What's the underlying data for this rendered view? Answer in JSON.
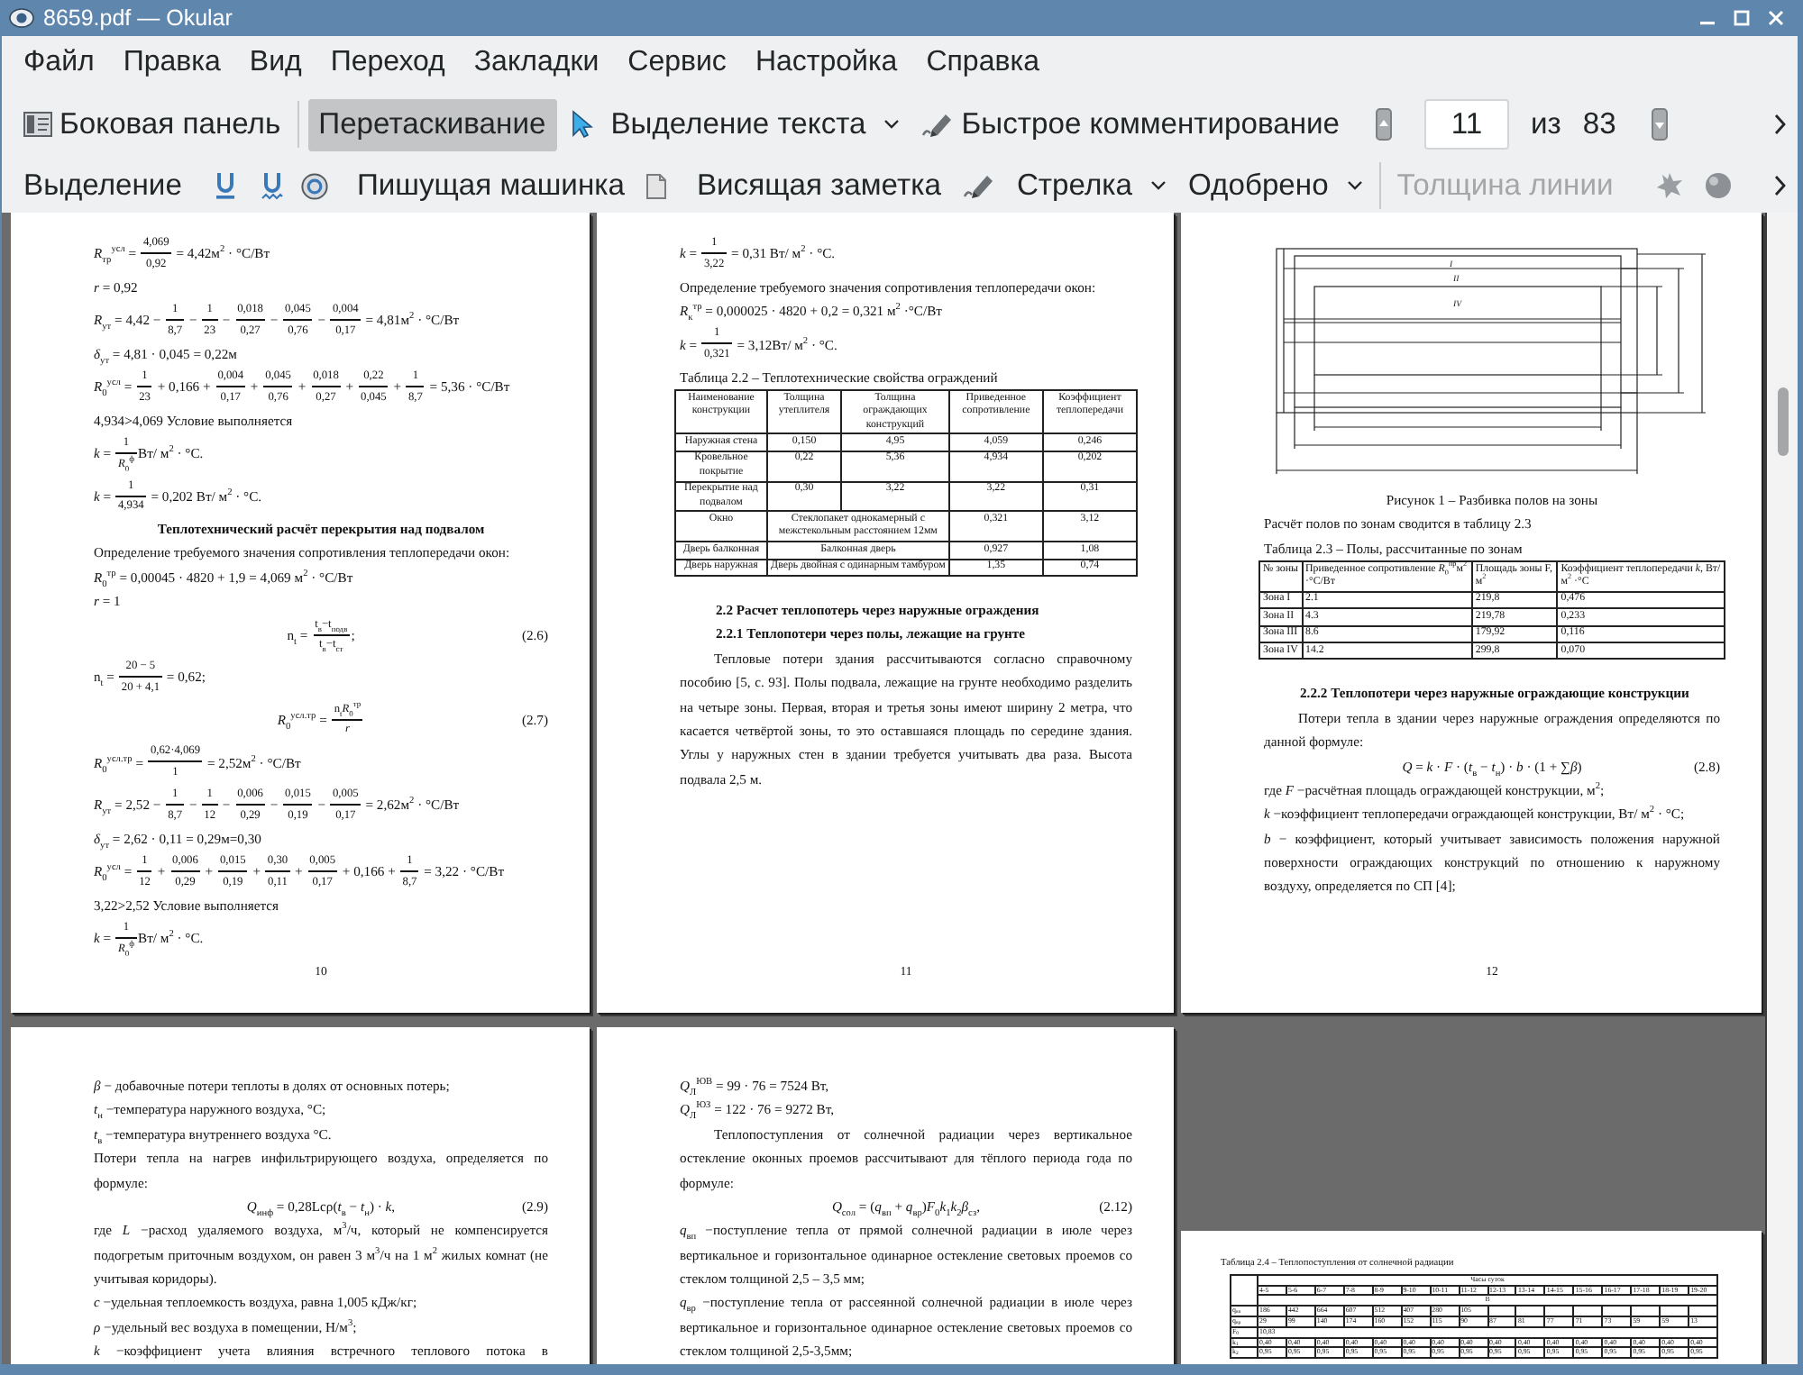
{
  "window": {
    "title": "8659.pdf — Okular"
  },
  "menu": [
    "Файл",
    "Правка",
    "Вид",
    "Переход",
    "Закладки",
    "Сервис",
    "Настройка",
    "Справка"
  ],
  "main_toolbar": {
    "tools": [
      {
        "label": "Боковая панель",
        "selected": false,
        "dropdown": false
      },
      {
        "label": "Перетаскивание",
        "selected": true,
        "dropdown": false
      },
      {
        "label": "Выделение текста",
        "selected": false,
        "dropdown": true
      },
      {
        "label": "Быстрое комментирование",
        "selected": false,
        "dropdown": false
      }
    ],
    "page_field": "11",
    "page_of": "из",
    "page_count": "83"
  },
  "annotation_toolbar": {
    "tools": [
      {
        "label": "Выделение",
        "dropdown": false
      },
      {
        "label": "Пишущая машинка",
        "dropdown": false
      },
      {
        "label": "Висящая заметка",
        "dropdown": false
      },
      {
        "label": "Стрелка",
        "dropdown": true
      },
      {
        "label": "Одобрено",
        "dropdown": true
      }
    ],
    "line_width": {
      "label": "Толщина линии",
      "disabled": true
    }
  },
  "pages": [
    {
      "number": "10",
      "landscape": false,
      "blocks": [
        {
          "kind": "formula",
          "parts": [
            {
              "kind": "text",
              "text": "*R*$_{тр}$$^{усл}$ = "
            },
            {
              "kind": "frac",
              "num": "4,069",
              "den": "0,92"
            },
            {
              "kind": "text",
              "text": " = 4,42м$^{2}$ · °C/Вт"
            }
          ]
        },
        {
          "kind": "line",
          "text": "*r* = 0,92",
          "centered": false
        },
        {
          "kind": "formula",
          "parts": [
            {
              "kind": "text",
              "text": "*R*$_{ут}$ = 4,42 − "
            },
            {
              "kind": "frac",
              "num": "1",
              "den": "8,7"
            },
            {
              "kind": "text",
              "text": " − "
            },
            {
              "kind": "frac",
              "num": "1",
              "den": "23"
            },
            {
              "kind": "text",
              "text": " − "
            },
            {
              "kind": "frac",
              "num": "0,018",
              "den": "0,27"
            },
            {
              "kind": "text",
              "text": " − "
            },
            {
              "kind": "frac",
              "num": "0,045",
              "den": "0,76"
            },
            {
              "kind": "text",
              "text": " − "
            },
            {
              "kind": "frac",
              "num": "0,004",
              "den": "0,17"
            },
            {
              "kind": "text",
              "text": " = 4,81м$^{2}$ · °C/Вт"
            }
          ]
        },
        {
          "kind": "line",
          "text": "*δ*$_{ут}$ = 4,81 · 0,045 = 0,22м",
          "centered": false
        },
        {
          "kind": "formula",
          "parts": [
            {
              "kind": "text",
              "text": "*R*$_{0}$$^{усл}$ = "
            },
            {
              "kind": "frac",
              "num": "1",
              "den": "23"
            },
            {
              "kind": "text",
              "text": " + 0,166 + "
            },
            {
              "kind": "frac",
              "num": "0,004",
              "den": "0,17"
            },
            {
              "kind": "text",
              "text": " + "
            },
            {
              "kind": "frac",
              "num": "0,045",
              "den": "0,76"
            },
            {
              "kind": "text",
              "text": " + "
            },
            {
              "kind": "frac",
              "num": "0,018",
              "den": "0,27"
            },
            {
              "kind": "text",
              "text": " + "
            },
            {
              "kind": "frac",
              "num": "0,22",
              "den": "0,045"
            },
            {
              "kind": "text",
              "text": " + "
            },
            {
              "kind": "frac",
              "num": "1",
              "den": "8,7"
            },
            {
              "kind": "text",
              "text": " = 5,36 · °C/Вт"
            }
          ]
        },
        {
          "kind": "line",
          "text": "4,934>4,069 Условие выполняется",
          "centered": false
        },
        {
          "kind": "formula",
          "parts": [
            {
              "kind": "text",
              "text": "*k* = "
            },
            {
              "kind": "frac",
              "num": "1",
              "den": "*R*$_{0}$$^{ф}$"
            },
            {
              "kind": "text",
              "text": "Вт/ м$^{2}$ · °C."
            }
          ]
        },
        {
          "kind": "formula",
          "parts": [
            {
              "kind": "text",
              "text": "*k* = "
            },
            {
              "kind": "frac",
              "num": "1",
              "den": "4,934"
            },
            {
              "kind": "text",
              "text": " = 0,202 Вт/ м$^{2}$ · °C."
            }
          ]
        },
        {
          "kind": "heading",
          "text": "Теплотехнический расчёт перекрытия над подвалом",
          "centered": true
        },
        {
          "kind": "line",
          "text": "Определение требуемого значения сопротивления теплопередачи окон:",
          "centered": false
        },
        {
          "kind": "line",
          "text": "*R*$_{0}$$^{тр}$ = 0,00045 · 4820 + 1,9 = 4,069 м$^{2}$ · °C/Вт",
          "centered": false
        },
        {
          "kind": "line",
          "text": "*r* = 1",
          "centered": false
        },
        {
          "kind": "formula",
          "number": "(2.6)",
          "parts": [
            {
              "kind": "text",
              "text": "n$_{t}$ = "
            },
            {
              "kind": "frac",
              "num": "t$_{в}$−t$_{подв}$",
              "den": "t$_{в}$−t$_{ст}$"
            },
            {
              "kind": "text",
              "text": ";"
            }
          ]
        },
        {
          "kind": "formula",
          "parts": [
            {
              "kind": "text",
              "text": "n$_{t}$ = "
            },
            {
              "kind": "frac",
              "num": "20 − 5",
              "den": "20 + 4,1"
            },
            {
              "kind": "text",
              "text": " = 0,62;"
            }
          ]
        },
        {
          "kind": "formula",
          "number": "(2.7)",
          "parts": [
            {
              "kind": "text",
              "text": "*R*$_{0}$$^{усл.тр}$ = "
            },
            {
              "kind": "frac",
              "num": "n$_{t}$*R*$_{0}$$^{тр}$",
              "den": "*r*"
            }
          ]
        },
        {
          "kind": "formula",
          "parts": [
            {
              "kind": "text",
              "text": "*R*$_{0}$$^{усл.тр}$ = "
            },
            {
              "kind": "frac",
              "num": "0,62·4,069",
              "den": "1"
            },
            {
              "kind": "text",
              "text": " = 2,52м$^{2}$ · °C/Вт"
            }
          ]
        },
        {
          "kind": "formula",
          "parts": [
            {
              "kind": "text",
              "text": "*R*$_{ут}$ = 2,52 − "
            },
            {
              "kind": "frac",
              "num": "1",
              "den": "8,7"
            },
            {
              "kind": "text",
              "text": " − "
            },
            {
              "kind": "frac",
              "num": "1",
              "den": "12"
            },
            {
              "kind": "text",
              "text": " − "
            },
            {
              "kind": "frac",
              "num": "0,006",
              "den": "0,29"
            },
            {
              "kind": "text",
              "text": " − "
            },
            {
              "kind": "frac",
              "num": "0,015",
              "den": "0,19"
            },
            {
              "kind": "text",
              "text": " − "
            },
            {
              "kind": "frac",
              "num": "0,005",
              "den": "0,17"
            },
            {
              "kind": "text",
              "text": " = 2,62м$^{2}$ · °C/Вт"
            }
          ]
        },
        {
          "kind": "line",
          "text": "*δ*$_{ут}$ = 2,62 · 0,11 = 0,29м=0,30",
          "centered": false
        },
        {
          "kind": "formula",
          "parts": [
            {
              "kind": "text",
              "text": "*R*$_{0}$$^{усл}$ = "
            },
            {
              "kind": "frac",
              "num": "1",
              "den": "12"
            },
            {
              "kind": "text",
              "text": " + "
            },
            {
              "kind": "frac",
              "num": "0,006",
              "den": "0,29"
            },
            {
              "kind": "text",
              "text": " + "
            },
            {
              "kind": "frac",
              "num": "0,015",
              "den": "0,19"
            },
            {
              "kind": "text",
              "text": " + "
            },
            {
              "kind": "frac",
              "num": "0,30",
              "den": "0,11"
            },
            {
              "kind": "text",
              "text": " + "
            },
            {
              "kind": "frac",
              "num": "0,005",
              "den": "0,17"
            },
            {
              "kind": "text",
              "text": " + 0,166 + "
            },
            {
              "kind": "frac",
              "num": "1",
              "den": "8,7"
            },
            {
              "kind": "text",
              "text": " = 3,22 · °C/Вт"
            }
          ]
        },
        {
          "kind": "line",
          "text": "3,22>2,52 Условие выполняется",
          "centered": false
        },
        {
          "kind": "formula",
          "parts": [
            {
              "kind": "text",
              "text": "*k* = "
            },
            {
              "kind": "frac",
              "num": "1",
              "den": "*R*$_{0}$$^{ф}$"
            },
            {
              "kind": "text",
              "text": "Вт/ м$^{2}$ · °C."
            }
          ]
        }
      ]
    },
    {
      "number": "11",
      "landscape": false,
      "blocks": [
        {
          "kind": "formula",
          "parts": [
            {
              "kind": "text",
              "text": "*k* = "
            },
            {
              "kind": "frac",
              "num": "1",
              "den": "3,22"
            },
            {
              "kind": "text",
              "text": " = 0,31 Вт/ м$^{2}$ · °C."
            }
          ]
        },
        {
          "kind": "line",
          "text": "Определение требуемого значения сопротивления теплопередачи окон:",
          "centered": false
        },
        {
          "kind": "line",
          "text": "*R*$_{к}$$^{тр}$ = 0,000025 · 4820 + 0,2 = 0,321 м$^{2}$ ·°C/Вт",
          "centered": false
        },
        {
          "kind": "formula",
          "parts": [
            {
              "kind": "text",
              "text": "*k* = "
            },
            {
              "kind": "frac",
              "num": "1",
              "den": "0,321"
            },
            {
              "kind": "text",
              "text": " = 3,12Вт/ м$^{2}$ · °C."
            }
          ]
        },
        {
          "kind": "line",
          "text": "Таблица 2.2 – Теплотехнические свойства ограждений",
          "centered": false
        },
        {
          "kind": "table",
          "centered": true,
          "header": [
            "Наименование конструкции",
            "Толщина утеплителя",
            "Толщина ограждающих конструкций",
            "Приведенное сопротивление",
            "Коэффициент теплопередачи"
          ],
          "rows": [
            [
              {
                "text": "Наружная стена"
              },
              {
                "text": "0,150"
              },
              {
                "text": "4,95"
              },
              {
                "text": "4,059"
              },
              {
                "text": "0,246"
              }
            ],
            [
              {
                "text": "Кровельное покрытие"
              },
              {
                "text": "0,22"
              },
              {
                "text": "5,36"
              },
              {
                "text": "4,934"
              },
              {
                "text": "0,202"
              }
            ],
            [
              {
                "text": "Перекрытие над подвалом"
              },
              {
                "text": "0,30"
              },
              {
                "text": "3,22"
              },
              {
                "text": "3,22"
              },
              {
                "text": "0,31"
              }
            ],
            [
              {
                "text": "Окно"
              },
              {
                "text": "Стеклопакет однокамерный с межстекольным расстоянием 12мм",
                "colspan": 2
              },
              {
                "text": "0,321"
              },
              {
                "text": "3,12"
              }
            ],
            [
              {
                "text": "Дверь балконная"
              },
              {
                "text": "Балконная дверь",
                "colspan": 2
              },
              {
                "text": "0,927"
              },
              {
                "text": "1,08"
              }
            ],
            [
              {
                "text": "Дверь наружная"
              },
              {
                "text": "Дверь двойная с одинарным тамбуром",
                "colspan": 2
              },
              {
                "text": "1,35"
              },
              {
                "text": "0,74"
              }
            ]
          ]
        },
        {
          "kind": "heading",
          "text": "2.2 Расчет теплопотерь через наружные ограждения",
          "centered": false
        },
        {
          "kind": "heading",
          "text": "2.2.1 Теплопотери через полы, лежащие на грунте",
          "centered": false
        },
        {
          "kind": "paragraph",
          "text": "Тепловые потери здания рассчитываются согласно справочному пособию [5, с. 93]. Полы подвала, лежащие на грунте необходимо разделить на четыре зоны. Первая, вторая и третья зоны имеют ширину 2 метра, что касается четвёртой зоны, то это оставшаяся площадь по середине здания. Углы у наружных стен в здании требуется учитывать два раза. Высота подвала 2,5 м.",
          "indent": true
        }
      ]
    },
    {
      "number": "12",
      "landscape": false,
      "blocks": [
        {
          "kind": "figure",
          "labels": [
            "I",
            "II",
            "IV"
          ]
        },
        {
          "kind": "line",
          "text": "Рисунок 1 – Разбивка полов на зоны",
          "centered": true
        },
        {
          "kind": "line",
          "text": "Расчёт полов по зонам сводится в таблицу 2.3",
          "centered": false
        },
        {
          "kind": "line",
          "text": "Таблица 2.3 – Полы, рассчитанные по зонам",
          "centered": false
        },
        {
          "kind": "table",
          "centered": false,
          "header": [
            "№ зоны",
            "Приведенное сопротивление *R*$_{0}$$^{пр}$м$^{2}$ ·°C/Вт",
            "Площадь зоны F, м$^{2}$",
            "Коэффициент теплопередачи *k*, Вт/ м$^{2}$ ·°C"
          ],
          "rows": [
            [
              {
                "text": "Зона I"
              },
              {
                "text": "2.1"
              },
              {
                "text": "219,8"
              },
              {
                "text": "0,476"
              }
            ],
            [
              {
                "text": "Зона II"
              },
              {
                "text": "4.3"
              },
              {
                "text": "219,78"
              },
              {
                "text": "0,233"
              }
            ],
            [
              {
                "text": "Зона III"
              },
              {
                "text": "8.6"
              },
              {
                "text": "179,92"
              },
              {
                "text": "0,116"
              }
            ],
            [
              {
                "text": "Зона IV"
              },
              {
                "text": "14.2"
              },
              {
                "text": "299,8"
              },
              {
                "text": "0,070"
              }
            ]
          ]
        },
        {
          "kind": "heading",
          "text": "2.2.2 Теплопотери через наружные ограждающие конструкции",
          "centered": false
        },
        {
          "kind": "paragraph",
          "text": "Потери тепла в здании через наружные ограждения определяются по данной формуле:",
          "indent": true
        },
        {
          "kind": "formula",
          "number": "(2.8)",
          "parts": [
            {
              "kind": "text",
              "text": "*Q* = *k* · *F* · (*t*$_{в}$ − *t*$_{н}$) · *b* · (1 + ∑*β*)"
            }
          ]
        },
        {
          "kind": "line",
          "text": "где *F* −расчётная площадь ограждающей конструкции, м$^{2}$;",
          "centered": false
        },
        {
          "kind": "line",
          "text": "*k* −коэффициент теплопередачи ограждающей конструкции, Вт/ м$^{2}$ · °C;",
          "centered": false
        },
        {
          "kind": "paragraph",
          "text": "*b* − коэффициент, который учитывает зависимость положения наружной поверхности ограждающих конструкций по отношению к наружному воздуху, определяется по СП [4];",
          "indent": false
        }
      ]
    },
    {
      "landscape": false,
      "blocks": [
        {
          "kind": "line",
          "text": "*β* − добавочные потери теплоты в долях от основных потерь;",
          "centered": false
        },
        {
          "kind": "line",
          "text": "*t*$_{н}$ −температура наружного воздуха, °C;",
          "centered": false
        },
        {
          "kind": "line",
          "text": "*t*$_{в}$ −температура внутреннего воздуха °C.",
          "centered": false
        },
        {
          "kind": "paragraph",
          "text": "Потери тепла на нагрев инфильтрирующего воздуха, определяется по формуле:",
          "indent": false
        },
        {
          "kind": "formula",
          "number": "(2.9)",
          "parts": [
            {
              "kind": "text",
              "text": "*Q*$_{инф}$ = 0,28Lcρ(*t*$_{в}$ − *t*$_{н}$) · *k*,"
            }
          ]
        },
        {
          "kind": "paragraph",
          "text": "где *L* −расход удаляемого воздуха, м$^{3}$/ч, который не компенсируется подогретым приточным воздухом, он равен 3 м$^{3}$/ч на 1 м$^{2}$ жилых комнат (не учитывая коридоры).",
          "indent": false
        },
        {
          "kind": "line",
          "text": "*c* −удельная теплоемкость воздуха, равна 1,005 кДж/кг;",
          "centered": false
        },
        {
          "kind": "line",
          "text": "*ρ* −удельный вес воздуха в помещении, Н/м$^{3}$;",
          "centered": false
        },
        {
          "kind": "paragraph",
          "text": "*k* −коэффициент учета влияния встречного теплового потока в",
          "indent": false,
          "continues": true
        }
      ]
    },
    {
      "landscape": false,
      "blocks": [
        {
          "kind": "line",
          "text": "*Q*$_{Л}$$^{ЮВ}$ = 99 · 76 = 7524 Вт,",
          "centered": false
        },
        {
          "kind": "line",
          "text": "*Q*$_{Л}$$^{ЮЗ}$ = 122 · 76 = 9272 Вт,",
          "centered": false
        },
        {
          "kind": "paragraph",
          "text": "Теплопоступления от солнечной радиации через вертикальное остекление оконных проемов рассчитывают для тёплого периода года по формуле:",
          "indent": true
        },
        {
          "kind": "formula",
          "number": "(2.12)",
          "parts": [
            {
              "kind": "text",
              "text": "*Q*$_{сол}$ = (*q*$_{вп}$ + *q*$_{вр}$)*F*$_{0}$*k*$_{1}$*k*$_{2}$*β*$_{сз}$,"
            }
          ]
        },
        {
          "kind": "paragraph",
          "text": "*q*$_{вп}$ −поступление тепла от прямой солнечной радиации в июле через вертикальное и горизонтальное одинарное остекление световых проемов со стеклом толщиной 2,5 – 3,5 мм;",
          "indent": false
        },
        {
          "kind": "paragraph",
          "text": "*q*$_{вр}$ −поступление тепла от рассеянной солнечной радиации в июле через вертикальное и горизонтальное одинарное остекление световых проемов со стеклом толщиной 2,5-3,5мм;",
          "indent": false
        }
      ]
    },
    {
      "landscape": true,
      "blocks": [
        {
          "kind": "line",
          "text": "Таблица 2.4 – Теплопоступления от солнечной радиации",
          "centered": false
        },
        {
          "kind": "hourly_table",
          "title": "Часы суток",
          "hours": [
            "4-5",
            "5-6",
            "6-7",
            "7-8",
            "8-9",
            "9-10",
            "10-11",
            "11-12",
            "12-13",
            "13-14",
            "14-15",
            "15-16",
            "16-17",
            "17-18",
            "18-19",
            "19-20"
          ],
          "group": "В",
          "rows": [
            [
              {
                "text": "q$_{вп}$"
              },
              {
                "text": "186"
              },
              {
                "text": "442"
              },
              {
                "text": "664"
              },
              {
                "text": "607"
              },
              {
                "text": "512"
              },
              {
                "text": "407"
              },
              {
                "text": "280"
              },
              {
                "text": "105"
              }
            ],
            [
              {
                "text": "q$_{вр}$"
              },
              {
                "text": "29"
              },
              {
                "text": "99"
              },
              {
                "text": "140"
              },
              {
                "text": "174"
              },
              {
                "text": "160"
              },
              {
                "text": "152"
              },
              {
                "text": "115"
              },
              {
                "text": "90"
              },
              {
                "text": "87"
              },
              {
                "text": "81"
              },
              {
                "text": "77"
              },
              {
                "text": "71"
              },
              {
                "text": "73"
              },
              {
                "text": "59"
              },
              {
                "text": "59"
              },
              {
                "text": "13"
              }
            ],
            [
              {
                "text": "F$_{0}$"
              },
              {
                "text": "10,83",
                "colspan": 16
              }
            ],
            [
              {
                "text": "k$_{1}$"
              },
              {
                "text": "0,40"
              },
              {
                "text": "0,40"
              },
              {
                "text": "0,40"
              },
              {
                "text": "0,40"
              },
              {
                "text": "0,40"
              },
              {
                "text": "0,40"
              },
              {
                "text": "0,40"
              },
              {
                "text": "0,40"
              },
              {
                "text": "0,40"
              },
              {
                "text": "0,40"
              },
              {
                "text": "0,40"
              },
              {
                "text": "0,40"
              },
              {
                "text": "0,40"
              },
              {
                "text": "0,40"
              },
              {
                "text": "0,40"
              },
              {
                "text": "0,40"
              }
            ],
            [
              {
                "text": "k$_{2}$"
              },
              {
                "text": "0,95"
              },
              {
                "text": "0,95"
              },
              {
                "text": "0,95"
              },
              {
                "text": "0,95"
              },
              {
                "text": "0,95"
              },
              {
                "text": "0,95"
              },
              {
                "text": "0,95"
              },
              {
                "text": "0,95"
              },
              {
                "text": "0,95"
              },
              {
                "text": "0,95"
              },
              {
                "text": "0,95"
              },
              {
                "text": "0,95"
              },
              {
                "text": "0,95"
              },
              {
                "text": "0,95"
              },
              {
                "text": "0,95"
              },
              {
                "text": "0,95"
              }
            ]
          ]
        }
      ]
    }
  ]
}
